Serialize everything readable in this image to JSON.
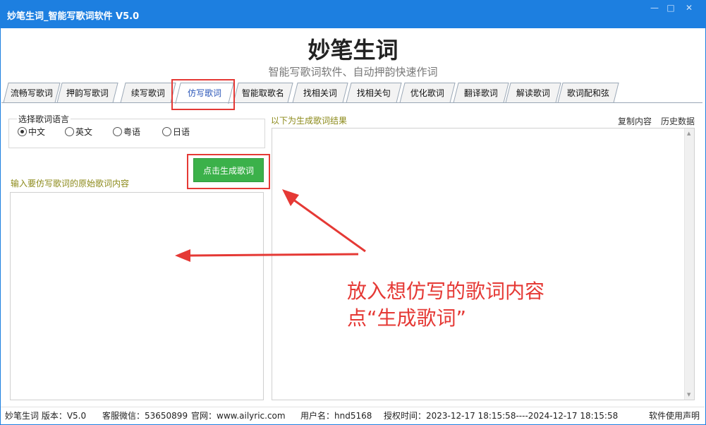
{
  "window": {
    "title": "妙笔生词_智能写歌词软件 V5.0",
    "controls": [
      "—",
      "□",
      "✕"
    ]
  },
  "header": {
    "title": "妙笔生词",
    "subtitle": "智能写歌词软件、自动押韵快速作词"
  },
  "tabs": [
    {
      "label": "流畅写歌词"
    },
    {
      "label": "押韵写歌词"
    },
    {
      "label": "续写歌词"
    },
    {
      "label": "仿写歌词",
      "active": true
    },
    {
      "label": "智能取歌名"
    },
    {
      "label": "找相关词"
    },
    {
      "label": "找相关句"
    },
    {
      "label": "优化歌词"
    },
    {
      "label": "翻译歌词"
    },
    {
      "label": "解读歌词"
    },
    {
      "label": "歌词配和弦"
    }
  ],
  "language": {
    "legend": "选择歌词语言",
    "options": [
      {
        "label": "中文",
        "checked": true
      },
      {
        "label": "英文",
        "checked": false
      },
      {
        "label": "粤语",
        "checked": false
      },
      {
        "label": "日语",
        "checked": false
      }
    ]
  },
  "generate_button": "点击生成歌词",
  "input_label": "输入要仿写歌词的原始歌词内容",
  "input_value": "",
  "result_label": "以下为生成歌词结果",
  "result_actions": {
    "copy": "复制内容",
    "history": "历史数据"
  },
  "result_value": "",
  "annotation": {
    "line1": "放入想仿写的歌词内容",
    "line2": "点“生成歌词”"
  },
  "status": {
    "app": "妙笔生词 版本：V5.0",
    "support": "客服微信：53650899",
    "website": "官网：www.ailyric.com",
    "user": "用户名：hnd5168",
    "license": "授权时间：2023-12-17 18:15:58----2024-12-17 18:15:58",
    "disclaimer": "软件使用声明"
  },
  "colors": {
    "titlebar": "#1d7fe0",
    "button_green": "#3bb14a",
    "annotation_red": "#e53935",
    "label_olive": "#8c8a1a"
  }
}
